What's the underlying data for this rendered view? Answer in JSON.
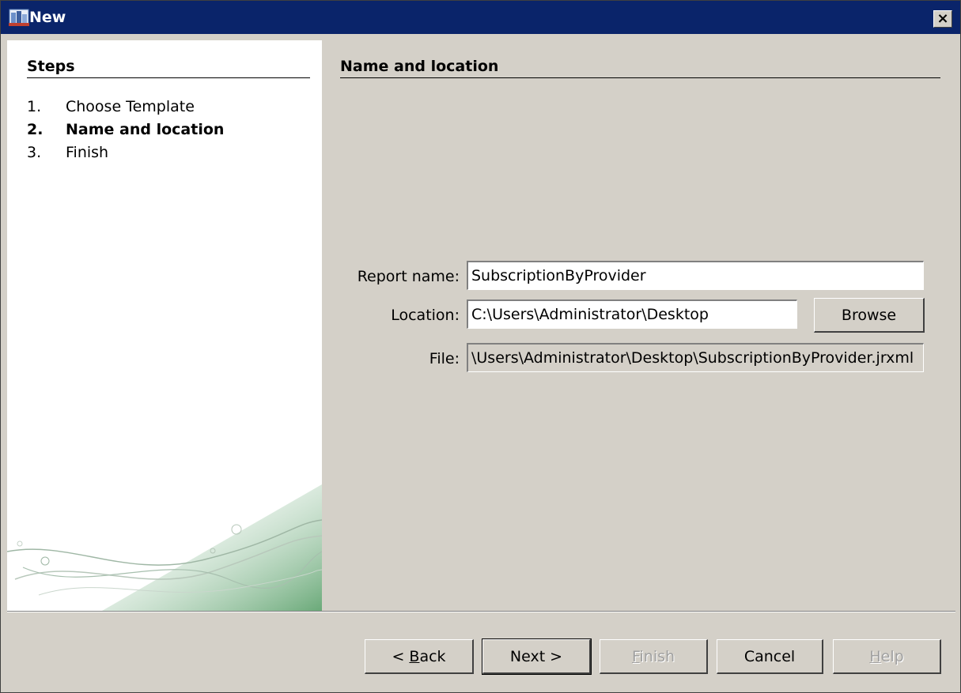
{
  "window": {
    "title": "New",
    "close_glyph": "×"
  },
  "steps": {
    "heading": "Steps",
    "items": [
      {
        "num": "1.",
        "label": "Choose Template"
      },
      {
        "num": "2.",
        "label": "Name and location"
      },
      {
        "num": "3.",
        "label": "Finish"
      }
    ]
  },
  "panel": {
    "title": "Name and location",
    "report_name_label": "Report name:",
    "report_name_value": "SubscriptionByProvider",
    "location_label": "Location:",
    "location_value": "C:\\Users\\Administrator\\Desktop",
    "browse_label": "Browse",
    "file_label": "File:",
    "file_value": "\\Users\\Administrator\\Desktop\\SubscriptionByProvider.jrxml"
  },
  "buttons": {
    "back_prefix": "< ",
    "back_mnemonic": "B",
    "back_rest": "ack",
    "next": "Next >",
    "finish_mnemonic": "F",
    "finish_rest": "inish",
    "cancel": "Cancel",
    "help_mnemonic": "H",
    "help_rest": "elp"
  },
  "icons": {
    "app": "report-wizard-icon",
    "close": "close-icon"
  }
}
